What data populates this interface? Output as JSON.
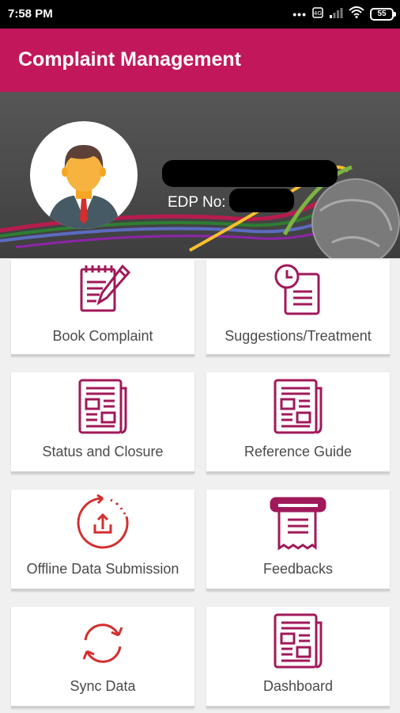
{
  "status_bar": {
    "time": "7:58 PM",
    "battery": "55",
    "icons": [
      "dots-icon",
      "volte-icon",
      "signal-icon",
      "wifi-icon",
      "battery-icon"
    ]
  },
  "app_bar": {
    "title": "Complaint Management",
    "color": "#c2185b"
  },
  "profile": {
    "edp_label": "EDP No:",
    "avatar_icon": "user-avatar-icon"
  },
  "menu": {
    "accent": "#a0195a",
    "red_accent": "#d32f2f",
    "items": [
      {
        "label": "Book Complaint",
        "icon": "notepad-pencil-icon"
      },
      {
        "label": "Suggestions/Treatment",
        "icon": "document-clock-icon"
      },
      {
        "label": "Status and Closure",
        "icon": "newspaper-icon"
      },
      {
        "label": "Reference Guide",
        "icon": "newspaper-icon"
      },
      {
        "label": "Offline Data Submission",
        "icon": "upload-refresh-icon"
      },
      {
        "label": "Feedbacks",
        "icon": "receipt-icon"
      },
      {
        "label": "Sync Data",
        "icon": "sync-icon"
      },
      {
        "label": "Dashboard",
        "icon": "newspaper-icon"
      }
    ]
  }
}
